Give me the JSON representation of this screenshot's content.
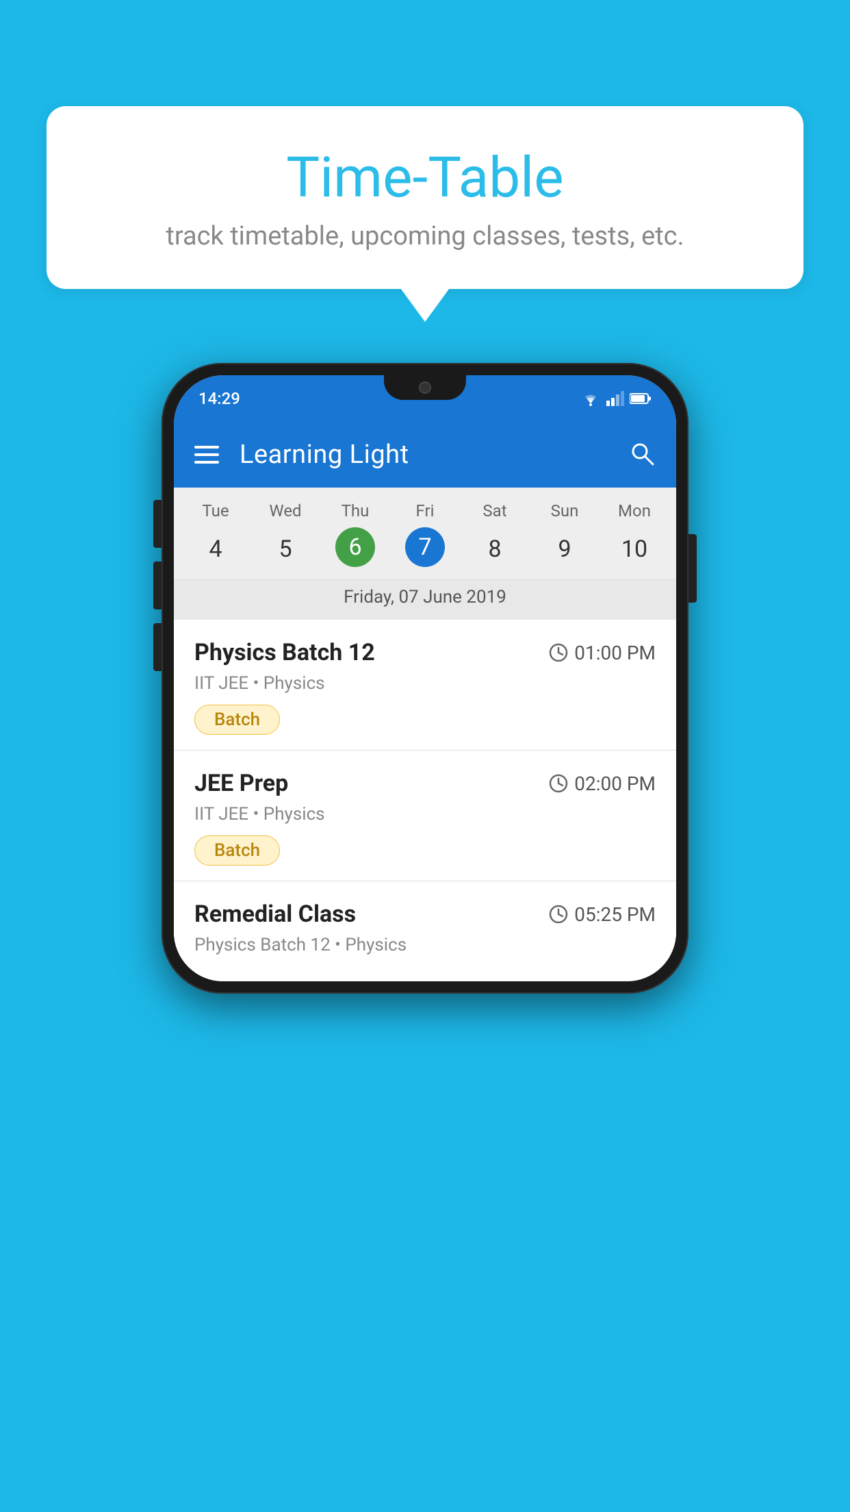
{
  "background": {
    "color": "#1DB8E8"
  },
  "speech_bubble": {
    "title": "Time-Table",
    "subtitle": "track timetable, upcoming classes, tests, etc."
  },
  "phone": {
    "status_bar": {
      "time": "14:29"
    },
    "app_bar": {
      "title": "Learning Light",
      "menu_icon": "hamburger-icon",
      "search_icon": "search-icon"
    },
    "calendar": {
      "days": [
        {
          "label": "Tue",
          "number": "4",
          "state": "normal"
        },
        {
          "label": "Wed",
          "number": "5",
          "state": "normal"
        },
        {
          "label": "Thu",
          "number": "6",
          "state": "today"
        },
        {
          "label": "Fri",
          "number": "7",
          "state": "selected"
        },
        {
          "label": "Sat",
          "number": "8",
          "state": "normal"
        },
        {
          "label": "Sun",
          "number": "9",
          "state": "normal"
        },
        {
          "label": "Mon",
          "number": "10",
          "state": "normal"
        }
      ],
      "selected_date_label": "Friday, 07 June 2019"
    },
    "classes": [
      {
        "name": "Physics Batch 12",
        "time": "01:00 PM",
        "subtitle": "IIT JEE • Physics",
        "tag": "Batch"
      },
      {
        "name": "JEE Prep",
        "time": "02:00 PM",
        "subtitle": "IIT JEE • Physics",
        "tag": "Batch"
      },
      {
        "name": "Remedial Class",
        "time": "05:25 PM",
        "subtitle": "Physics Batch 12 • Physics",
        "tag": null
      }
    ]
  }
}
